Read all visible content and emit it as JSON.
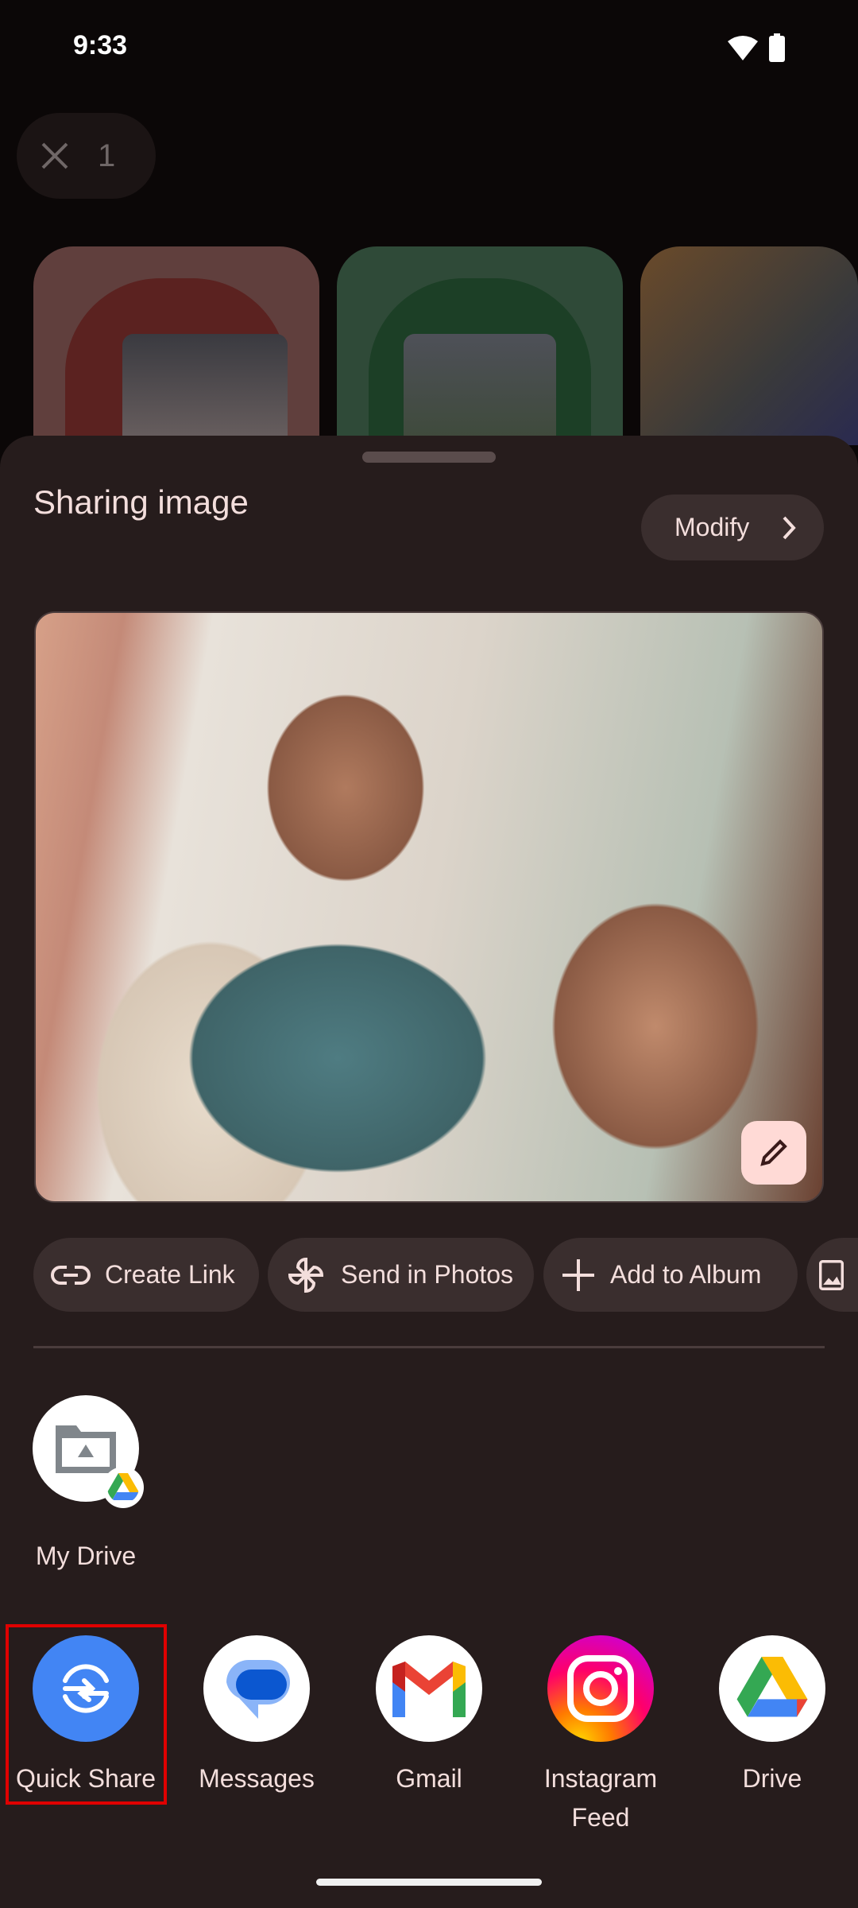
{
  "status_bar": {
    "time": "9:33",
    "icons": [
      "wifi-icon",
      "battery-icon"
    ]
  },
  "selection": {
    "count": "1",
    "icon": "close-icon"
  },
  "sheet": {
    "title": "Sharing image",
    "modify_label": "Modify",
    "actions": [
      {
        "label": "Create Link",
        "icon": "link-icon"
      },
      {
        "label": "Send in Photos",
        "icon": "pinwheel-icon"
      },
      {
        "label": "Add to Album",
        "icon": "plus-icon"
      },
      {
        "label": "",
        "icon": "photo-album-icon"
      }
    ],
    "direct_targets": [
      {
        "label": "My Drive",
        "icon": "drive-folder-icon"
      }
    ],
    "apps": [
      {
        "label": "Quick Share",
        "icon": "quick-share-icon",
        "highlighted": true
      },
      {
        "label": "Messages",
        "icon": "messages-icon"
      },
      {
        "label": "Gmail",
        "icon": "gmail-icon"
      },
      {
        "label": "Instagram",
        "sublabel": "Feed",
        "icon": "instagram-icon"
      },
      {
        "label": "Drive",
        "icon": "drive-icon"
      }
    ]
  },
  "colors": {
    "sheet_bg": "#261c1c",
    "chip_bg": "#3a2e2e",
    "highlight": "#e00000",
    "quick_share": "#4285f4"
  }
}
